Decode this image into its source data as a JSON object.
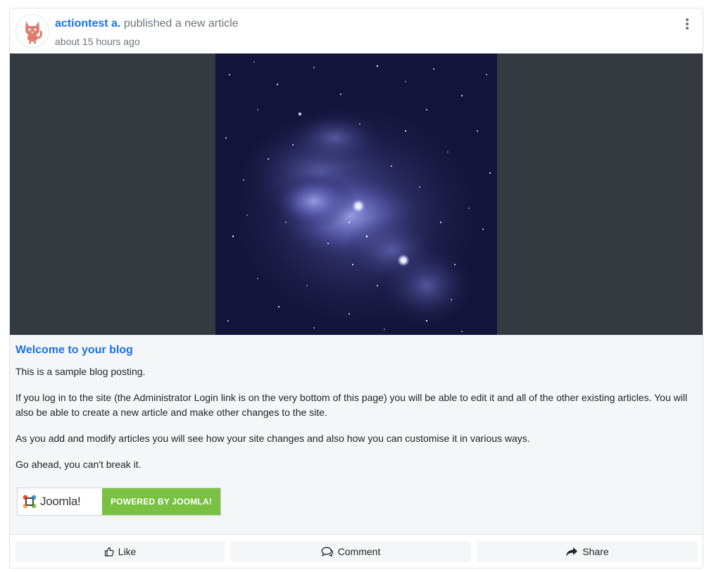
{
  "post": {
    "author": "actiontest a.",
    "action": "published a new article",
    "time": "about 15 hours ago"
  },
  "icons": {
    "avatar": "cat-avatar-icon",
    "menu": "vertical-ellipsis-icon",
    "like": "thumbs-up-icon",
    "comment": "comment-icon",
    "share": "share-arrow-icon"
  },
  "article": {
    "title": "Welcome to your blog",
    "paragraphs": [
      "This is a sample blog posting.",
      "If you log in to the site (the Administrator Login link is on the very bottom of this page) you will be able to edit it and all of the other existing articles. You will also be able to create a new article and make other changes to the site.",
      "As you add and modify articles you will see how your site changes and also how you can customise it in various ways.",
      "Go ahead, you can't break it."
    ],
    "badge": {
      "logo_text": "Joomla!",
      "label": "POWERED BY JOOMLA!"
    }
  },
  "actions": {
    "like": "Like",
    "comment": "Comment",
    "share": "Share"
  },
  "colors": {
    "accent": "#1a73e8",
    "badge_green": "#7ac143",
    "media_bg": "#343a40"
  }
}
